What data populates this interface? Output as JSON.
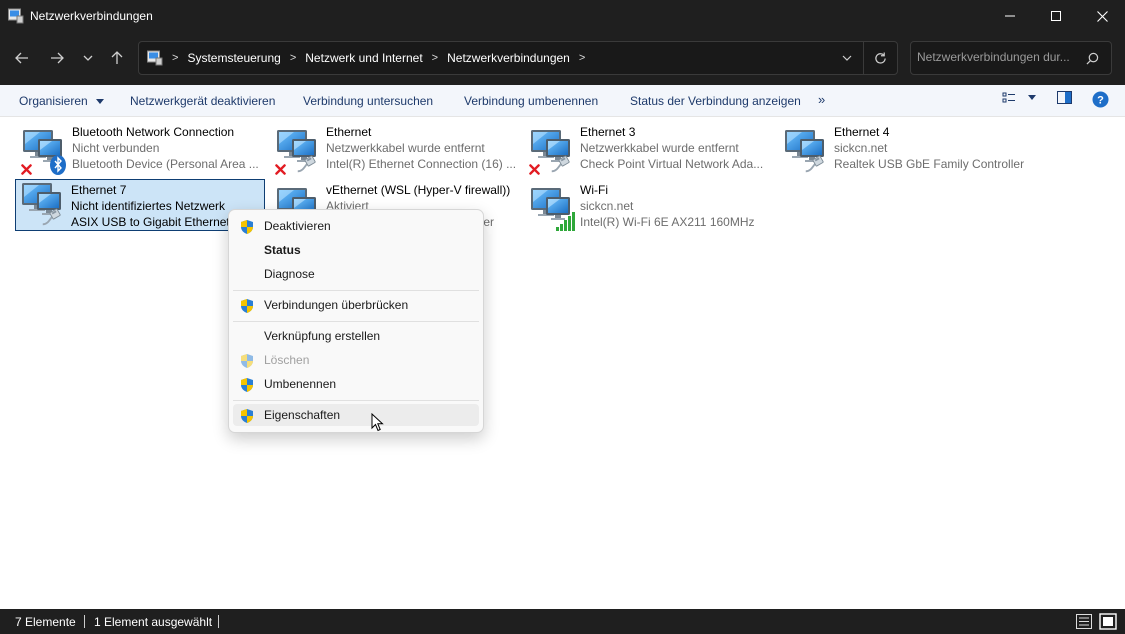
{
  "window": {
    "title": "Netzwerkverbindungen",
    "minimize_icon": "minimize-icon",
    "maximize_icon": "maximize-icon",
    "close_icon": "close-icon"
  },
  "address_bar": {
    "breadcrumb": [
      "Systemsteuerung",
      "Netzwerk und Internet",
      "Netzwerkverbindungen"
    ],
    "search_placeholder": "Netzwerkverbindungen dur..."
  },
  "command_bar": {
    "organize": "Organisieren",
    "commands": [
      "Netzwerkgerät deaktivieren",
      "Verbindung untersuchen",
      "Verbindung umbenennen",
      "Status der Verbindung anzeigen"
    ],
    "more": "»"
  },
  "connections": [
    {
      "name": "Bluetooth Network Connection",
      "status": "Nicht verbunden",
      "device": "Bluetooth Device (Personal Area ...",
      "overlay": "bluetooth-disconnected"
    },
    {
      "name": "Ethernet",
      "status": "Netzwerkkabel wurde entfernt",
      "device": "Intel(R) Ethernet Connection (16) ...",
      "overlay": "cable-disconnected"
    },
    {
      "name": "Ethernet 3",
      "status": "Netzwerkkabel wurde entfernt",
      "device": "Check Point Virtual Network Ada...",
      "overlay": "cable-disconnected"
    },
    {
      "name": "Ethernet 4",
      "status": "sickcn.net",
      "device": "Realtek USB GbE Family Controller",
      "overlay": "cable"
    },
    {
      "name": "Ethernet 7",
      "status": "Nicht identifiziertes Netzwerk",
      "device": "ASIX USB to Gigabit Ethernet F",
      "overlay": "cable",
      "selected": true
    },
    {
      "name": "vEthernet (WSL (Hyper-V firewall))",
      "status": "Aktiviert",
      "device": "ter",
      "overlay": "cable"
    },
    {
      "name": "Wi-Fi",
      "status": "sickcn.net",
      "device": "Intel(R) Wi-Fi 6E AX211 160MHz",
      "overlay": "wifi"
    }
  ],
  "context_menu": {
    "items": [
      {
        "label": "Deaktivieren",
        "shield": true
      },
      {
        "label": "Status",
        "bold": true
      },
      {
        "label": "Diagnose"
      },
      {
        "label": "Verbindungen überbrücken",
        "shield": true
      },
      {
        "label": "Verknüpfung erstellen"
      },
      {
        "label": "Löschen",
        "shield": true,
        "disabled": true
      },
      {
        "label": "Umbenennen",
        "shield": true
      },
      {
        "label": "Eigenschaften",
        "shield": true,
        "hover": true
      }
    ]
  },
  "status_bar": {
    "count": "7 Elemente",
    "selected": "1 Element ausgewählt"
  },
  "colors": {
    "titlebar_bg": "#1f1f1f",
    "selection_bg": "#cce4f7",
    "selection_border": "#0e3e73",
    "command_text": "#1e3a6b",
    "subtext": "#6d6d6d"
  }
}
